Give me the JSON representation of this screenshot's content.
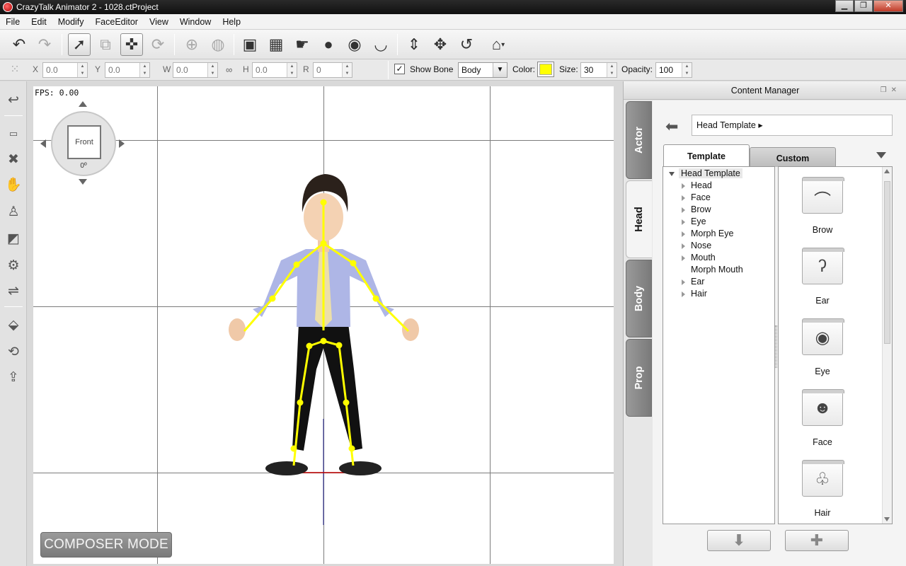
{
  "window": {
    "title": "CrazyTalk Animator 2  - 1028.ctProject",
    "controls": {
      "minimize": "▁",
      "maximize": "❐",
      "close": "✕"
    }
  },
  "menu": [
    "File",
    "Edit",
    "Modify",
    "FaceEditor",
    "View",
    "Window",
    "Help"
  ],
  "toolbar": {
    "icons": [
      "undo-icon",
      "redo-icon",
      "select-icon",
      "group-icon",
      "bone-edit-icon",
      "bone-reset-icon",
      "add-bone-icon",
      "add-point-icon",
      "face-puppet-icon",
      "sprite-editor-icon",
      "motion-key-icon",
      "head-icon",
      "eye-icon",
      "lips-icon",
      "move-vertical-icon",
      "move-icon",
      "rotate-icon",
      "home-icon"
    ]
  },
  "transform": {
    "x_label": "X",
    "x_value": "0.0",
    "y_label": "Y",
    "y_value": "0.0",
    "w_label": "W",
    "w_value": "0.0",
    "h_label": "H",
    "h_value": "0.0",
    "r_label": "R",
    "r_value": "0",
    "show_bone_label": "Show Bone",
    "show_bone_checked": "✓",
    "bone_mode": "Body",
    "color_label": "Color:",
    "bone_color": "#ffff00",
    "size_label": "Size:",
    "size_value": "30",
    "opacity_label": "Opacity:",
    "opacity_value": "100"
  },
  "stage": {
    "fps": "FPS: 0.00",
    "camera_view": "Front",
    "camera_angle": "0º",
    "composer_mode": "COMPOSER MODE"
  },
  "content_manager": {
    "title": "Content Manager",
    "side_tabs": [
      "Actor",
      "Head",
      "Body",
      "Prop"
    ],
    "active_side_tab": "Head",
    "path": "Head Template ▸",
    "tabs": [
      "Template",
      "Custom"
    ],
    "tree_root": "Head Template",
    "tree_items": [
      {
        "label": "Head",
        "expandable": true
      },
      {
        "label": "Face",
        "expandable": true
      },
      {
        "label": "Brow",
        "expandable": true
      },
      {
        "label": "Eye",
        "expandable": true
      },
      {
        "label": "Morph Eye",
        "expandable": true
      },
      {
        "label": "Nose",
        "expandable": true
      },
      {
        "label": "Mouth",
        "expandable": true
      },
      {
        "label": "Morph Mouth",
        "expandable": false
      },
      {
        "label": "Ear",
        "expandable": true
      },
      {
        "label": "Hair",
        "expandable": true
      }
    ],
    "tiles": [
      {
        "label": "Brow",
        "icon": "brow-icon",
        "glyph": "⌒"
      },
      {
        "label": "Ear",
        "icon": "ear-icon",
        "glyph": "ʔ"
      },
      {
        "label": "Eye",
        "icon": "eye-icon",
        "glyph": "◉"
      },
      {
        "label": "Face",
        "icon": "face-icon",
        "glyph": "☻"
      },
      {
        "label": "Hair",
        "icon": "hair-icon",
        "glyph": "♧"
      }
    ],
    "bottom_buttons": {
      "apply": "⬇",
      "add": "✚"
    }
  }
}
